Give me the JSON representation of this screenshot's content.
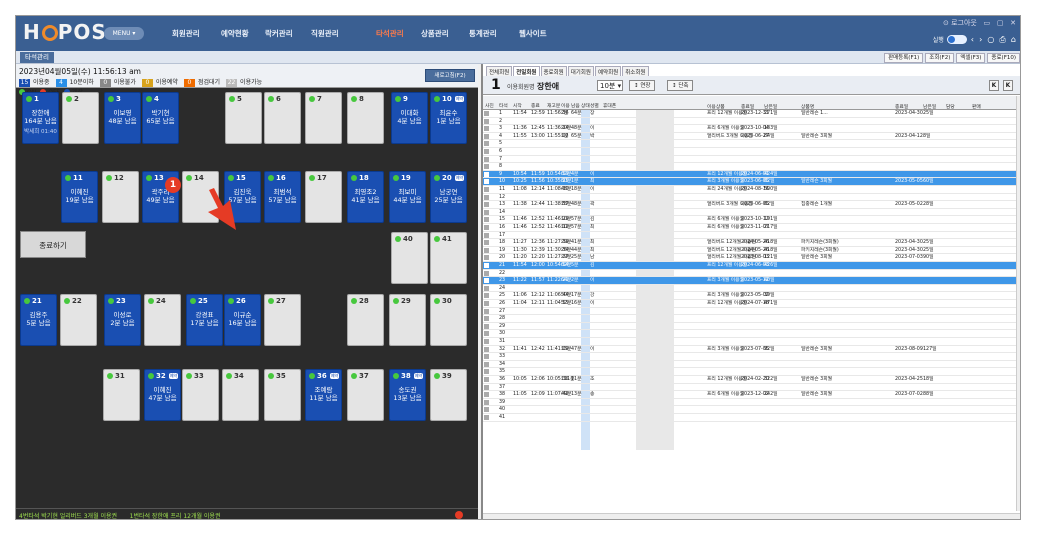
{
  "app": {
    "logo": "HOPOS",
    "menu_btn": "MENU"
  },
  "nav": [
    "회원관리",
    "예약현황",
    "락커관리",
    "직원관리",
    "타석관리",
    "상품관리",
    "통계관리",
    "웹사이트"
  ],
  "nav_active": 4,
  "win_controls": "로그아웃",
  "top_right": {
    "label": "실행"
  },
  "subbar": {
    "tab": "타석관리",
    "buttons": [
      "판매등록(F1)",
      "조회(F2)",
      "엑셀(F3)",
      "종료(F10)"
    ]
  },
  "left": {
    "datetime": "2023년04월05일(수) 11:56:13 am",
    "legend": [
      {
        "count": "15",
        "label": "이용중",
        "color": "#1a4fb2"
      },
      {
        "count": "4",
        "label": "10분이하",
        "color": "#2a8fe8"
      },
      {
        "count": "0",
        "label": "이용불가",
        "color": "#888888"
      },
      {
        "count": "0",
        "label": "이용예약",
        "color": "#d7a21c"
      },
      {
        "count": "0",
        "label": "점검대기",
        "color": "#ef6c00"
      },
      {
        "count": "22",
        "label": "이용가능",
        "color": "#bbbbbb"
      }
    ],
    "legend_row2": [
      "ON",
      "OFF",
      "개장"
    ],
    "reserve_btn": "새로고침(F2)",
    "end_btn": "종료하기",
    "badge": "1",
    "status": [
      "4번타석 박기현 얼리버드 3개월 이용권",
      "1번타석 장한애 프리 12개월 이용권"
    ]
  },
  "seats": [
    {
      "n": "1",
      "busy": true,
      "name": "장한애",
      "left": "164분 남음",
      "extra": "박세희",
      "extra2": "01:40"
    },
    {
      "n": "2",
      "busy": false
    },
    {
      "n": "3",
      "busy": true,
      "name": "이보영",
      "left": "48분 남음"
    },
    {
      "n": "4",
      "busy": true,
      "name": "박기현",
      "left": "65분 남음"
    },
    {
      "n": "5",
      "busy": false
    },
    {
      "n": "6",
      "busy": false
    },
    {
      "n": "7",
      "busy": false
    },
    {
      "n": "8",
      "busy": false
    },
    {
      "n": "9",
      "busy": true,
      "name": "이대화",
      "left": "4분 남음"
    },
    {
      "n": "10",
      "busy": true,
      "name": "최윤수",
      "left": "1분 남음",
      "tag": "예약"
    },
    {
      "n": "11",
      "busy": true,
      "name": "이혜진",
      "left": "19분 남음"
    },
    {
      "n": "12",
      "busy": false
    },
    {
      "n": "13",
      "busy": true,
      "name": "곽주리",
      "left": "49분 남음"
    },
    {
      "n": "14",
      "busy": false
    },
    {
      "n": "15",
      "busy": true,
      "name": "김진욱",
      "left": "57분 남음"
    },
    {
      "n": "16",
      "busy": true,
      "name": "최범석",
      "left": "57분 남음"
    },
    {
      "n": "17",
      "busy": false
    },
    {
      "n": "18",
      "busy": true,
      "name": "최영조2",
      "left": "41분 남음"
    },
    {
      "n": "19",
      "busy": true,
      "name": "최보미",
      "left": "44분 남음"
    },
    {
      "n": "20",
      "busy": true,
      "name": "남궁연",
      "left": "25분 남음",
      "tag": "예약"
    },
    {
      "n": "40",
      "busy": false
    },
    {
      "n": "41",
      "busy": false
    },
    {
      "n": "21",
      "busy": true,
      "name": "김용주",
      "left": "5분 남음"
    },
    {
      "n": "22",
      "busy": false
    },
    {
      "n": "23",
      "busy": true,
      "name": "이성로",
      "left": "2분 남음"
    },
    {
      "n": "24",
      "busy": false
    },
    {
      "n": "25",
      "busy": true,
      "name": "강경표",
      "left": "17분 남음"
    },
    {
      "n": "26",
      "busy": true,
      "name": "이규순",
      "left": "16분 남음"
    },
    {
      "n": "27",
      "busy": false
    },
    {
      "n": "28",
      "busy": false
    },
    {
      "n": "29",
      "busy": false
    },
    {
      "n": "30",
      "busy": false
    },
    {
      "n": "31",
      "busy": false
    },
    {
      "n": "32",
      "busy": true,
      "name": "이혜진",
      "left": "47분 남음",
      "tag": "예약"
    },
    {
      "n": "33",
      "busy": false
    },
    {
      "n": "34",
      "busy": false
    },
    {
      "n": "35",
      "busy": false
    },
    {
      "n": "36",
      "busy": true,
      "name": "조예람",
      "left": "11분 남음",
      "tag": "예약"
    },
    {
      "n": "37",
      "busy": false
    },
    {
      "n": "38",
      "busy": true,
      "name": "송도권",
      "left": "13분 남음",
      "tag": "예약"
    },
    {
      "n": "39",
      "busy": false
    }
  ],
  "right": {
    "tabs": [
      "전체회원",
      "전일회원",
      "종료회원",
      "대기회원",
      "예약회원",
      "취소회원"
    ],
    "tab_sel": 1,
    "head": {
      "num": "1",
      "lbl": "이용회원명",
      "name": "장한애",
      "sel": "10분",
      "btn1": "연장",
      "btn2": "단축",
      "k1": "K",
      "k2": "K"
    },
    "columns": [
      "사진",
      "타석",
      "시작",
      "종료",
      "재고분",
      "이용",
      "남음",
      "상태",
      "성별",
      "휴대폰",
      "이용상품",
      "종료일",
      "남은일",
      "상품명",
      "종료일",
      "남은일",
      "담당",
      "판매"
    ],
    "rows": [
      {
        "no": "1",
        "s": "11:54",
        "e": "12:59",
        "r": "11:56:36",
        "u": "2분",
        "l": "64분",
        "nm": "장",
        "p1": "프리 12개월 이용권",
        "d1": "2023-12-31",
        "ld": "271일",
        "p2": "일반레슨 1...",
        "d2": "2023-04-30",
        "ld2": "25일",
        "hl": false
      },
      {
        "no": "2",
        "hl": false
      },
      {
        "no": "3",
        "s": "11:36",
        "e": "12:45",
        "r": "11:36:24",
        "u": "20분",
        "l": "48분",
        "nm": "이",
        "p1": "프리 6개월 이용권",
        "d1": "2023-10-04",
        "ld": "183일",
        "hl": false
      },
      {
        "no": "4",
        "s": "11:55",
        "e": "13:00",
        "r": "11:55:02",
        "u": "1분",
        "l": "65분",
        "nm": "박",
        "p1": "얼리버드 3개월 이용권",
        "d1": "2023-06-27",
        "ld": "84일",
        "p2": "일반레슨 3회월",
        "d2": "2023-04-12",
        "ld2": "8일",
        "hl": false
      },
      {
        "no": "5",
        "hl": false
      },
      {
        "no": "6",
        "hl": false
      },
      {
        "no": "7",
        "hl": false
      },
      {
        "no": "8",
        "hl": false
      },
      {
        "no": "9",
        "s": "10:54",
        "e": "11:59",
        "r": "10:54:59",
        "u": "62분",
        "l": "4분",
        "nm": "이",
        "p1": "프리 12개월 이용권",
        "d1": "2024-06-01",
        "ld": "424일",
        "hl": true
      },
      {
        "no": "10",
        "s": "10:25",
        "e": "11:56",
        "r": "10:35:25",
        "u": "80분",
        "l": "1분",
        "nm": "최",
        "p1": "프리 3개월 이용권",
        "d1": "2023-06-05",
        "ld": "62일",
        "p2": "일반레슨 3회월",
        "d2": "2023-05-05",
        "ld2": "60일",
        "hl": true
      },
      {
        "no": "11",
        "s": "11:08",
        "e": "12:14",
        "r": "11:08:30",
        "u": "48분",
        "l": "18분",
        "nm": "이",
        "p1": "프리 24개월 이용권",
        "d1": "2024-08-16",
        "ld": "500일",
        "hl": false
      },
      {
        "no": "12",
        "hl": false
      },
      {
        "no": "13",
        "s": "11:38",
        "e": "12:44",
        "r": "11:38:57",
        "u": "18분",
        "l": "48분",
        "nm": "곽",
        "p1": "얼리버드 3개월 이용권",
        "d1": "2023-06-05",
        "ld": "62일",
        "p2": "집중레슨 1개월",
        "d2": "2023-05-02",
        "ld2": "28일",
        "hl": false
      },
      {
        "no": "14",
        "hl": false
      },
      {
        "no": "15",
        "s": "11:46",
        "e": "12:52",
        "r": "11:46:29",
        "u": "10분",
        "l": "57분",
        "nm": "김",
        "p1": "프리 6개월 이용권",
        "d1": "2023-10-12",
        "ld": "191일",
        "hl": false
      },
      {
        "no": "16",
        "s": "11:46",
        "e": "12:52",
        "r": "11:46:12",
        "u": "10분",
        "l": "57분",
        "nm": "최",
        "p1": "프리 6개월 이용권",
        "d1": "2023-11-07",
        "ld": "217일",
        "hl": false
      },
      {
        "no": "17",
        "hl": false
      },
      {
        "no": "18",
        "s": "11:27",
        "e": "12:36",
        "r": "11:27:19",
        "u": "29분",
        "l": "41분",
        "nm": "최",
        "p1": "얼리버드 12개월 이용권",
        "d1": "2024-05-26",
        "ld": "418일",
        "p2": "파키지레슨(3회월)",
        "d2": "2023-04-30",
        "ld2": "25일",
        "hl": false
      },
      {
        "no": "19",
        "s": "11:30",
        "e": "12:39",
        "r": "11:30:34",
        "u": "26분",
        "l": "44분",
        "nm": "최",
        "p1": "얼리버드 12개월 이용권",
        "d1": "2024-05-26",
        "ld": "418일",
        "p2": "파키지레슨(3회월)",
        "d2": "2023-04-30",
        "ld2": "25일",
        "hl": false
      },
      {
        "no": "20",
        "s": "11:20",
        "e": "12:20",
        "r": "11:27:27",
        "u": "29분",
        "l": "25분",
        "nm": "남",
        "p1": "얼리버드 12개월 이용권",
        "d1": "2023-08-03",
        "ld": "121일",
        "p2": "일반레슨 3회월",
        "d2": "2023-07-03",
        "ld2": "90일",
        "hl": false
      },
      {
        "no": "21",
        "s": "11:54",
        "e": "12:00",
        "r": "10:54:54",
        "u": "62분",
        "l": "5분",
        "nm": "김",
        "p1": "프리 12개월 이용권",
        "d1": "2024-06-03",
        "ld": "426일",
        "hl": true
      },
      {
        "no": "22",
        "hl": false
      },
      {
        "no": "23",
        "s": "11:22",
        "e": "11:57",
        "r": "11:22:21",
        "u": "64분",
        "l": "2분",
        "nm": "이",
        "p1": "프리 3개월 이용권",
        "d1": "2023-05-12",
        "ld": "40일",
        "hl": true
      },
      {
        "no": "24",
        "hl": false
      },
      {
        "no": "25",
        "s": "11:06",
        "e": "12:12",
        "r": "11:06:44",
        "u": "50분",
        "l": "17분",
        "nm": "강",
        "p1": "프리 3개월 이용권",
        "d1": "2023-05-02",
        "ld": "39일",
        "hl": false
      },
      {
        "no": "26",
        "s": "11:04",
        "e": "12:11",
        "r": "11:04:55",
        "u": "52분",
        "l": "16분",
        "nm": "이",
        "p1": "프리 12개월 이용권",
        "d1": "2024-07-18",
        "ld": "471일",
        "hl": false
      },
      {
        "no": "27",
        "hl": false
      },
      {
        "no": "28",
        "hl": false
      },
      {
        "no": "29",
        "hl": false
      },
      {
        "no": "30",
        "hl": false
      },
      {
        "no": "31",
        "hl": false
      },
      {
        "no": "32",
        "s": "11:41",
        "e": "12:42",
        "r": "11:41:09",
        "u": "15분",
        "l": "47분",
        "nm": "이",
        "p1": "프리 3개월 이용권",
        "d1": "2023-07-05",
        "ld": "92일",
        "p2": "일반레슨 3회월",
        "d2": "2023-08-09",
        "ld2": "127일",
        "hl": false
      },
      {
        "no": "33",
        "hl": false
      },
      {
        "no": "34",
        "hl": false
      },
      {
        "no": "35",
        "hl": false
      },
      {
        "no": "36",
        "s": "10:05",
        "e": "12:06",
        "r": "10:05:36",
        "u": "111분",
        "l": "11분",
        "nm": "조",
        "p1": "프리 12개월 이용권",
        "d1": "2024-02-20",
        "ld": "322일",
        "p2": "일반레슨 3회월",
        "d2": "2023-04-25",
        "ld2": "18일",
        "hl": false
      },
      {
        "no": "37",
        "hl": false
      },
      {
        "no": "38",
        "s": "11:05",
        "e": "12:09",
        "r": "11:07:42",
        "u": "49분",
        "l": "13분",
        "nm": "송",
        "p1": "프리 6개월 이용권",
        "d1": "2023-12-02",
        "ld": "242일",
        "p2": "일반레슨 3회월",
        "d2": "2023-07-02",
        "ld2": "88일",
        "hl": false
      },
      {
        "no": "39",
        "hl": false
      },
      {
        "no": "40",
        "hl": false
      },
      {
        "no": "41",
        "hl": false
      }
    ]
  }
}
